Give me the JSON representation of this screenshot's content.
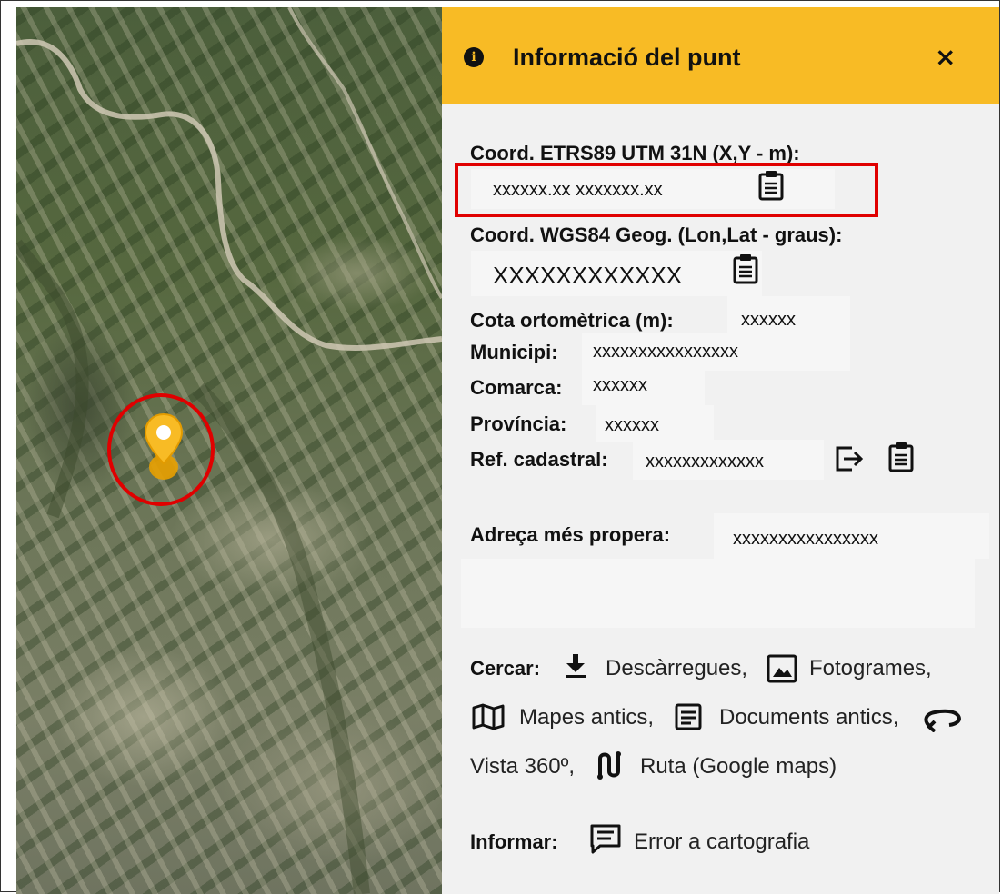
{
  "panel": {
    "title": "Informació del punt",
    "close_label": "×",
    "info_icon_glyph": "i",
    "header_color": "#f8bb25",
    "highlight_color": "#e00000"
  },
  "fields": {
    "utm_label": "Coord. ETRS89 UTM 31N (X,Y - m):",
    "utm_value": "xxxxxx.xx xxxxxxx.xx",
    "wgs_label": "Coord. WGS84 Geog. (Lon,Lat - graus):",
    "wgs_value": "XXXXXXXXXXXX",
    "cota_label": "Cota ortomètrica (m):",
    "cota_value": "xxxxxx",
    "municipi_label": "Municipi:",
    "municipi_value": "xxxxxxxxxxxxxxxx",
    "comarca_label": "Comarca:",
    "comarca_value": "xxxxxx",
    "provincia_label": "Província:",
    "provincia_value": "xxxxxx",
    "refcad_label": "Ref. cadastral:",
    "refcad_value": "xxxxxxxxxxxxx",
    "adreca_label": "Adreça més propera:",
    "adreca_value": "xxxxxxxxxxxxxxxx"
  },
  "search": {
    "label": "Cercar:",
    "descarregues": "Descàrregues,",
    "fotogrames": "Fotogrames,",
    "mapes_antics": "Mapes antics,",
    "documents_antics": "Documents antics,",
    "vista360": "Vista 360º,",
    "ruta": "Ruta (Google maps)"
  },
  "report": {
    "label": "Informar:",
    "error": "Error a cartografia"
  },
  "icons": [
    "info-icon",
    "close-icon",
    "clipboard-icon",
    "external-link-icon",
    "download-icon",
    "image-icon",
    "map-icon",
    "document-icon",
    "rotate-360-icon",
    "route-icon",
    "comment-icon",
    "location-pin-icon"
  ]
}
